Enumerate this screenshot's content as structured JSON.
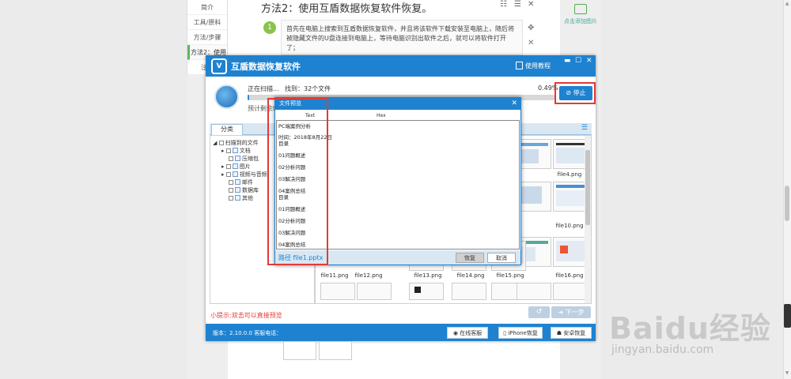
{
  "page": {
    "heading": "方法2：使用互盾数据恢复软件恢复。",
    "nav_items": [
      "简介",
      "工具/原料",
      "方法/步骤",
      "方法2：使用",
      "注意"
    ],
    "step_number": "1",
    "step_text": "首先在电脑上搜索到互盾数据恢复软件，并且将该软件下载安装至电脑上，随后将被隐藏文件的U盘连接到电脑上，等待电脑识别出软件之后，就可以将软件打开了；",
    "add_image_label": "点击添加图片"
  },
  "app": {
    "title": "互盾数据恢复软件",
    "tutorial_label": "使用教程",
    "status_scanning": "正在扫描...",
    "status_found": "找到：32个文件",
    "progress_text": "0.49%",
    "progress_value": 0.49,
    "remaining_label": "预计剩余时",
    "stop_label": "停止",
    "tab_category": "分类",
    "tree": {
      "root": "扫描到的文件",
      "items": [
        "文档",
        "压缩包",
        "图片",
        "视频与音频",
        "邮件",
        "数据库",
        "其他"
      ]
    },
    "file_names": [
      "file4.png",
      "file10.png",
      "file11.png",
      "file12.png",
      "file13.png",
      "file14.png",
      "file15.png",
      "file16.png"
    ],
    "hint": "小提示:双击可以直接预览",
    "next_label": "下一步",
    "version_text": "版本：2.10.0.0 客服电话：",
    "footer_buttons": [
      "在线客服",
      "iPhone恢复",
      "安卓恢复"
    ]
  },
  "preview": {
    "title": "文件预览",
    "col_text": "Text",
    "col_hex": "Hex",
    "lines": [
      "PC端案例分析",
      "时间：2018年8月22日",
      "目录",
      "01问题概述",
      "02分析问题",
      "03解决问题",
      "04案例总结",
      "目录",
      "01问题概述",
      "02分析问题",
      "03解决问题",
      "04案例总结"
    ],
    "path_label": "路径 file1.pptx",
    "recover_label": "恢复",
    "cancel_label": "取消"
  },
  "watermark": {
    "brand": "Baidu经验",
    "url": "jingyan.baidu.com"
  },
  "colors": {
    "app_blue": "#1e82d0",
    "highlight_red": "#e53935",
    "step_green": "#8bc34a"
  }
}
